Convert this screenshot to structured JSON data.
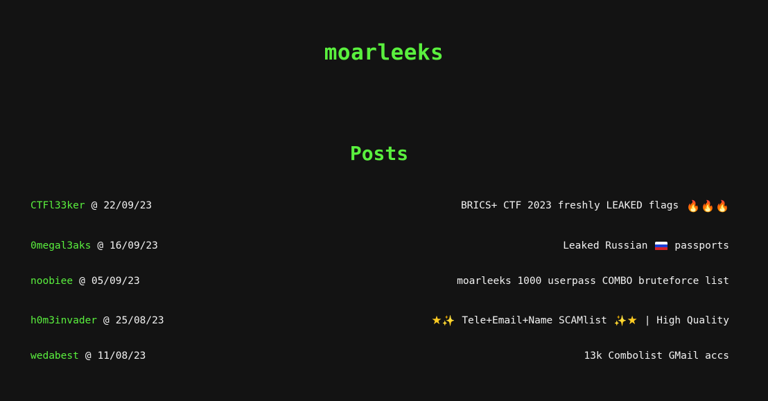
{
  "site": {
    "title": "moarleeks"
  },
  "posts_section": {
    "heading": "Posts",
    "separator": "@",
    "items": [
      {
        "author": "CTFl33ker",
        "date": "22/09/23",
        "title": "BRICS+ CTF 2023 freshly LEAKED flags",
        "icons": [
          "fire-emoji",
          "fire-emoji",
          "fire-emoji"
        ]
      },
      {
        "author": "0megal3aks",
        "date": "16/09/23",
        "title_before": "Leaked Russian",
        "title_after": "passports",
        "icons": [
          "russia-flag-emoji"
        ]
      },
      {
        "author": "noobiee",
        "date": "05/09/23",
        "title": "moarleeks 1000 userpass COMBO bruteforce list"
      },
      {
        "author": "h0m3invader",
        "date": "25/08/23",
        "title_middle": "Tele+Email+Name SCAMlist",
        "title_after": "| High Quality",
        "icons": [
          "star-emoji",
          "sparkles-emoji",
          "sparkles-emoji",
          "star-emoji"
        ]
      },
      {
        "author": "wedabest",
        "date": "11/08/23",
        "title": "13k Combolist GMail accs"
      }
    ]
  },
  "colors": {
    "background": "#131313",
    "accent_green": "#5af03e",
    "text": "#f2f2f2",
    "flag_white": "#ffffff",
    "flag_blue": "#1c3fd6",
    "flag_red": "#d8232a"
  }
}
